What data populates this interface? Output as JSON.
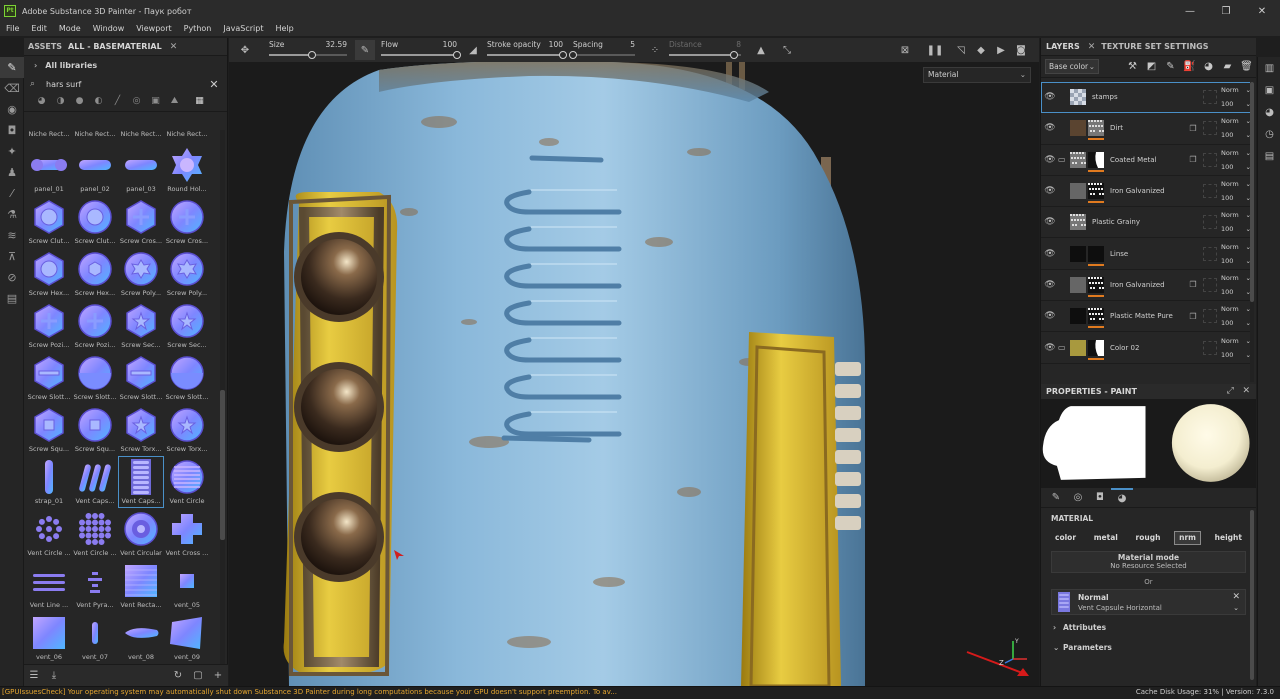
{
  "window": {
    "logo_text": "Pt",
    "title": "Adobe Substance 3D Painter - Паук робот",
    "controls": [
      "—",
      "❐",
      "✕"
    ]
  },
  "menu": [
    "File",
    "Edit",
    "Mode",
    "Window",
    "Viewport",
    "Python",
    "JavaScript",
    "Help"
  ],
  "assets": {
    "tab1": "ASSETS",
    "tab2": "ALL - BASEMATERIAL",
    "all_libraries": "All libraries",
    "search_value": "hars surf",
    "top_row_labels": [
      "Niche Rect...",
      "Niche Rect...",
      "Niche Rect...",
      "Niche Rect..."
    ],
    "items": [
      {
        "label": "panel_01",
        "shape": "pill-knob"
      },
      {
        "label": "panel_02",
        "shape": "pill"
      },
      {
        "label": "panel_03",
        "shape": "pill"
      },
      {
        "label": "Round Hol...",
        "shape": "round-hole"
      },
      {
        "label": "Screw Clut...",
        "shape": "hex"
      },
      {
        "label": "Screw Clut...",
        "shape": "circle"
      },
      {
        "label": "Screw Cros...",
        "shape": "hex-cross"
      },
      {
        "label": "Screw Cros...",
        "shape": "circle-cross"
      },
      {
        "label": "Screw Hex...",
        "shape": "hex"
      },
      {
        "label": "Screw Hex...",
        "shape": "circle-hex"
      },
      {
        "label": "Screw Poly...",
        "shape": "circle-gear"
      },
      {
        "label": "Screw Poly...",
        "shape": "circle-gear"
      },
      {
        "label": "Screw Pozi...",
        "shape": "hex-cross"
      },
      {
        "label": "Screw Pozi...",
        "shape": "circle-cross"
      },
      {
        "label": "Screw Sec...",
        "shape": "hex-star"
      },
      {
        "label": "Screw Sec...",
        "shape": "circle-star"
      },
      {
        "label": "Screw Slott...",
        "shape": "hex-slot"
      },
      {
        "label": "Screw Slott...",
        "shape": "circle-slot"
      },
      {
        "label": "Screw Slott...",
        "shape": "hex-slot"
      },
      {
        "label": "Screw Slott...",
        "shape": "circle-slot"
      },
      {
        "label": "Screw Squ...",
        "shape": "hex-square"
      },
      {
        "label": "Screw Squ...",
        "shape": "circle-square"
      },
      {
        "label": "Screw Torx...",
        "shape": "hex-star"
      },
      {
        "label": "Screw Torx...",
        "shape": "circle-star"
      },
      {
        "label": "strap_01",
        "shape": "strap"
      },
      {
        "label": "Vent Caps...",
        "shape": "vent-diag"
      },
      {
        "label": "Vent Caps...",
        "shape": "vent-caps",
        "selected": true
      },
      {
        "label": "Vent Circle",
        "shape": "vent-circle"
      },
      {
        "label": "Vent Circle ...",
        "shape": "dots-circle"
      },
      {
        "label": "Vent Circle ...",
        "shape": "dots-circle-big"
      },
      {
        "label": "Vent Circular",
        "shape": "vent-circular"
      },
      {
        "label": "Vent Cross ...",
        "shape": "vent-cross"
      },
      {
        "label": "Vent Line ...",
        "shape": "vent-lines"
      },
      {
        "label": "Vent Pyra...",
        "shape": "vent-pyra"
      },
      {
        "label": "Vent Recta...",
        "shape": "vent-rect"
      },
      {
        "label": "vent_05",
        "shape": "small-square"
      },
      {
        "label": "vent_06",
        "shape": "square"
      },
      {
        "label": "vent_07",
        "shape": "strap-small"
      },
      {
        "label": "vent_08",
        "shape": "drop"
      },
      {
        "label": "vent_09",
        "shape": "quad"
      }
    ]
  },
  "paint_toolbar": {
    "size": {
      "label": "Size",
      "value": "32.59",
      "fraction": 0.55
    },
    "flow": {
      "label": "Flow",
      "value": "100",
      "fraction": 1.0
    },
    "stroke_opacity": {
      "label": "Stroke opacity",
      "value": "100",
      "fraction": 1.0
    },
    "spacing": {
      "label": "Spacing",
      "value": "5",
      "fraction": 0.0
    },
    "distance": {
      "label": "Distance",
      "value": "8",
      "fraction": 0.9
    }
  },
  "viewport": {
    "mode_dropdown": "Material"
  },
  "layers": {
    "tab1": "LAYERS",
    "tab2": "TEXTURE SET SETTINGS",
    "channel": "Base color",
    "rows": [
      {
        "name": "stamps",
        "blend": "Norm",
        "opacity": "100",
        "folder": false,
        "thumb": "checker",
        "mask": "",
        "selected": true,
        "fx": false
      },
      {
        "name": "Dirt",
        "blend": "Norm",
        "opacity": "100",
        "folder": false,
        "thumb": "brown",
        "mask": "noise",
        "selected": false,
        "fx": true
      },
      {
        "name": "Coated Metal",
        "blend": "Norm",
        "opacity": "100",
        "folder": true,
        "thumb": "noise",
        "mask": "blackwhite",
        "selected": false,
        "fx": true
      },
      {
        "name": "Iron Galvanized",
        "blend": "Norm",
        "opacity": "100",
        "folder": false,
        "thumb": "grey",
        "mask": "dark-noise",
        "selected": false,
        "fx": false
      },
      {
        "name": "Plastic Grainy",
        "blend": "Norm",
        "opacity": "100",
        "folder": false,
        "thumb": "noise",
        "mask": "",
        "selected": false,
        "fx": false
      },
      {
        "name": "Linse",
        "blend": "Norm",
        "opacity": "100",
        "folder": false,
        "thumb": "black",
        "mask": "black",
        "selected": false,
        "fx": false
      },
      {
        "name": "Iron Galvanized",
        "blend": "Norm",
        "opacity": "100",
        "folder": false,
        "thumb": "grey",
        "mask": "dark-noise",
        "selected": false,
        "fx": true
      },
      {
        "name": "Plastic Matte Pure",
        "blend": "Norm",
        "opacity": "100",
        "folder": false,
        "thumb": "black",
        "mask": "dark-noise",
        "selected": false,
        "fx": true
      },
      {
        "name": "Color 02",
        "blend": "Norm",
        "opacity": "100",
        "folder": true,
        "thumb": "olive",
        "mask": "blackwhite",
        "selected": false,
        "fx": false
      }
    ]
  },
  "properties": {
    "title": "PROPERTIES - PAINT",
    "material_title": "MATERIAL",
    "channels": [
      "color",
      "metal",
      "rough",
      "nrm",
      "height"
    ],
    "active_channel": "nrm",
    "material_mode_title": "Material mode",
    "material_mode_value": "No Resource Selected",
    "or": "Or",
    "resource_title": "Normal",
    "resource_name": "Vent Capsule Horizontal",
    "attributes": "Attributes",
    "parameters": "Parameters"
  },
  "status": {
    "message": "[GPUIssuesCheck] Your operating system may automatically shut down Substance 3D Painter during long computations because your GPU doesn't support preemption. To av...",
    "right": "Cache Disk Usage:   31% | Version: 7.3.0"
  },
  "colors": {
    "accent": "#4a90c8",
    "layer_mask_bar": "#e07a1f",
    "status_warning": "#e5a630",
    "model_blue": "#8fbfde",
    "model_yellow": "#e5c436"
  },
  "icons": {
    "left_tools": [
      "brush-icon",
      "eraser-icon",
      "projection-icon",
      "polygon-fill-icon",
      "smudge-icon",
      "clone-icon",
      "picker-icon",
      "bake-icon",
      "layers-stack-icon",
      "anchor-icon",
      "eraser2-icon",
      "document-icon"
    ],
    "right_tools": [
      "layers-icon",
      "display-icon",
      "shader-icon",
      "history-icon",
      "log-icon"
    ]
  }
}
